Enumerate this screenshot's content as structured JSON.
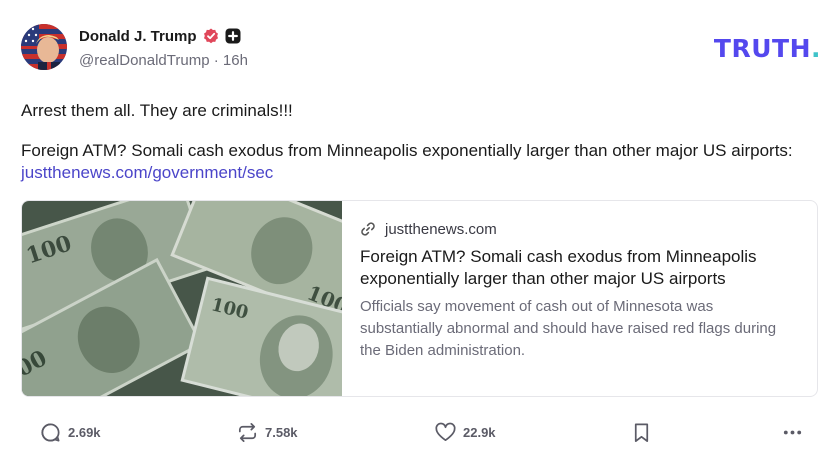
{
  "author": {
    "display_name": "Donald J. Trump",
    "handle": "@realDonaldTrump",
    "separator": "·",
    "time_ago": "16h"
  },
  "brand": {
    "logo_text": "TRUTH",
    "logo_dot": ".",
    "logo_color": "#5448ee",
    "dot_color": "#3fc3c9"
  },
  "post": {
    "line1": "Arrest them all. They are criminals!!!",
    "line2": "Foreign ATM? Somali cash exodus from Minneapolis exponentially larger than other major US airports:",
    "link_text": "justthenews.com/government/sec"
  },
  "link_card": {
    "domain": "justthenews.com",
    "title": "Foreign ATM? Somali cash exodus from Minneapolis exponentially larger than other major US airports",
    "description": "Officials say movement of cash out of Minnesota was substantially abnormal and should have raised red flags during the Biden administration."
  },
  "actions": {
    "replies": "2.69k",
    "retruths": "7.58k",
    "likes": "22.9k"
  },
  "icons": [
    "verified-icon",
    "plus-badge-icon",
    "link-icon",
    "reply-icon",
    "retruth-icon",
    "heart-icon",
    "bookmark-icon",
    "more-icon"
  ]
}
